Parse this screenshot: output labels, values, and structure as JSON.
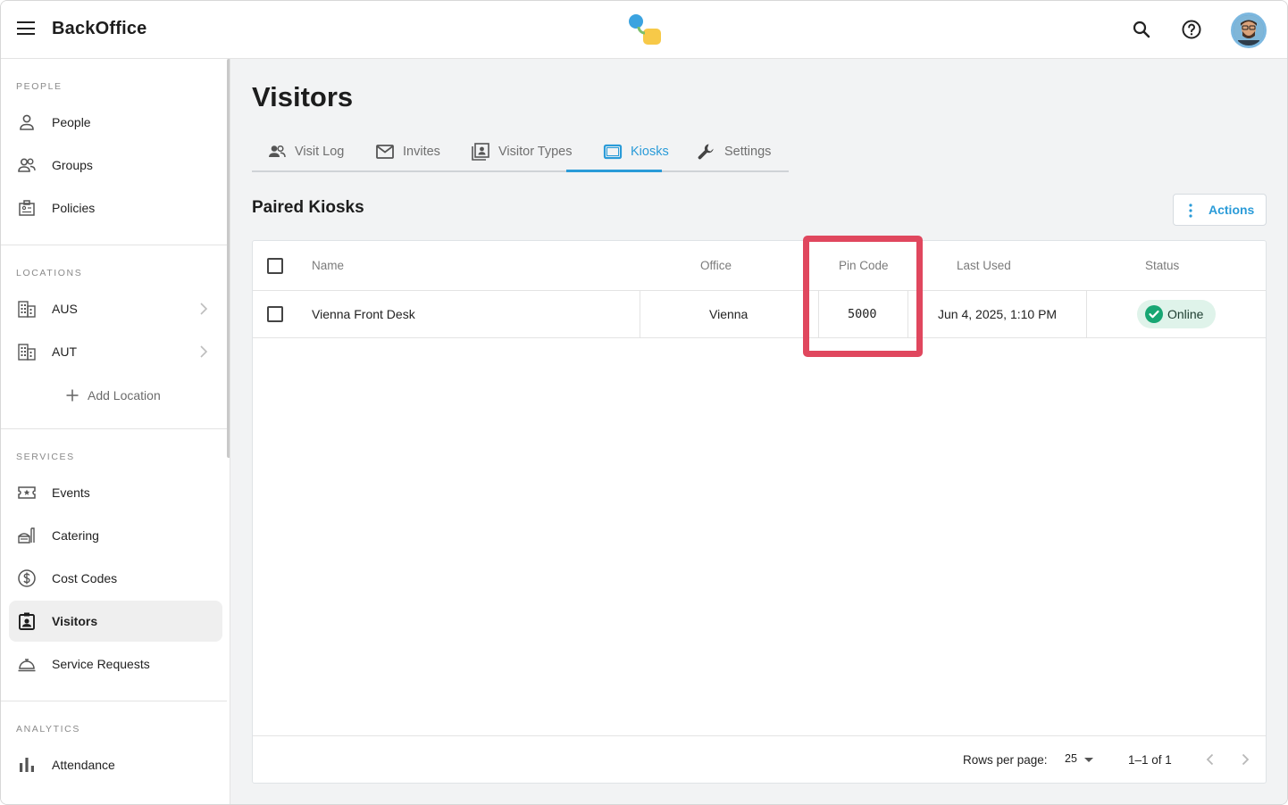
{
  "app": {
    "title": "BackOffice"
  },
  "sidebar": {
    "sections": [
      {
        "label": "PEOPLE"
      },
      {
        "label": "LOCATIONS"
      },
      {
        "label": "SERVICES"
      },
      {
        "label": "ANALYTICS"
      }
    ],
    "people_items": [
      {
        "label": "People",
        "icon": "person-icon"
      },
      {
        "label": "Groups",
        "icon": "group-icon"
      },
      {
        "label": "Policies",
        "icon": "policy-icon"
      }
    ],
    "location_items": [
      {
        "label": "AUS",
        "icon": "building-icon"
      },
      {
        "label": "AUT",
        "icon": "building-icon"
      }
    ],
    "add_location_label": "Add Location",
    "service_items": [
      {
        "label": "Events",
        "icon": "ticket-icon"
      },
      {
        "label": "Catering",
        "icon": "catering-icon"
      },
      {
        "label": "Cost Codes",
        "icon": "dollar-icon"
      },
      {
        "label": "Visitors",
        "icon": "badge-icon",
        "active": true
      },
      {
        "label": "Service Requests",
        "icon": "bell-icon"
      }
    ],
    "analytics_items": [
      {
        "label": "Attendance",
        "icon": "bar-chart-icon"
      }
    ]
  },
  "main": {
    "title": "Visitors",
    "tabs": [
      {
        "label": "Visit Log",
        "icon": "people-icon"
      },
      {
        "label": "Invites",
        "icon": "mail-icon"
      },
      {
        "label": "Visitor Types",
        "icon": "id-card-icon"
      },
      {
        "label": "Kiosks",
        "icon": "tablet-icon",
        "active": true
      },
      {
        "label": "Settings",
        "icon": "wrench-icon"
      }
    ],
    "section_title": "Paired Kiosks",
    "actions_label": "Actions",
    "table": {
      "columns": [
        "Name",
        "Office",
        "Pin Code",
        "Last Used",
        "Status"
      ],
      "rows": [
        {
          "name": "Vienna Front Desk",
          "office": "Vienna",
          "pin": "5000",
          "last_used": "Jun 4, 2025, 1:10 PM",
          "status": "Online"
        }
      ]
    },
    "footer": {
      "rows_per_page_label": "Rows per page:",
      "rows_per_page_value": "25",
      "range": "1–1 of 1"
    }
  },
  "colors": {
    "accent": "#2a9bd8",
    "online_bg": "#dff3ea",
    "online_check": "#17a673",
    "highlight": "#e0475e"
  }
}
